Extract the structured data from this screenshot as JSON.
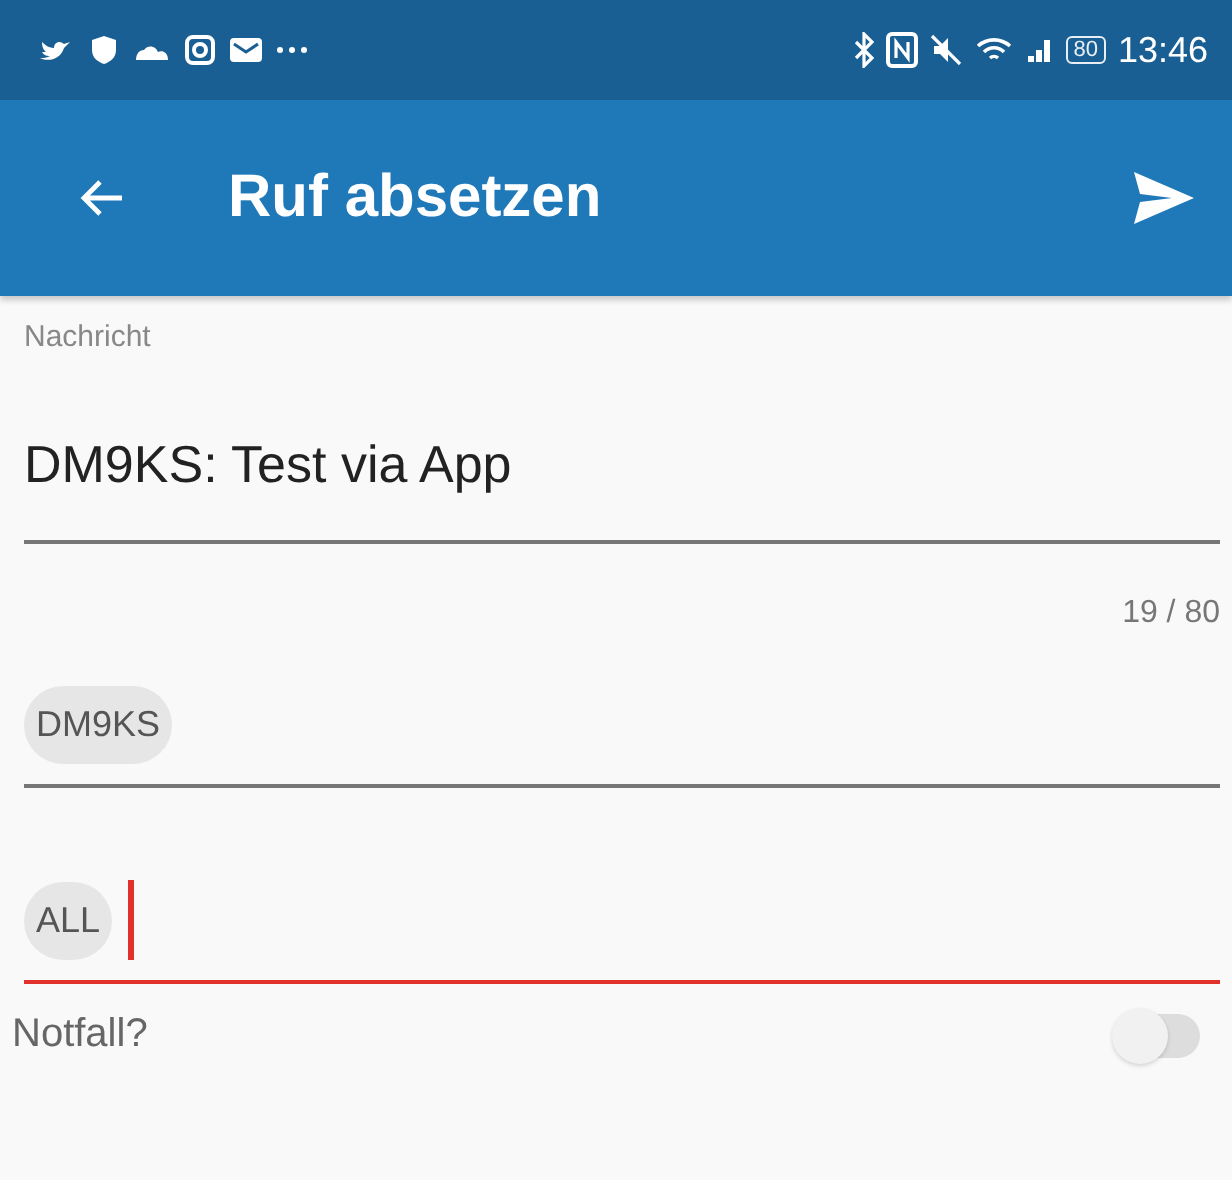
{
  "status_bar": {
    "battery": "80",
    "time": "13:46"
  },
  "app_bar": {
    "title": "Ruf absetzen"
  },
  "message": {
    "label": "Nachricht",
    "value": "DM9KS: Test via App",
    "counter": "19 / 80"
  },
  "recipient_fields": [
    {
      "chip": "DM9KS",
      "focused": false
    },
    {
      "chip": "ALL",
      "focused": true
    }
  ],
  "emergency": {
    "label": "Notfall?",
    "on": false
  }
}
